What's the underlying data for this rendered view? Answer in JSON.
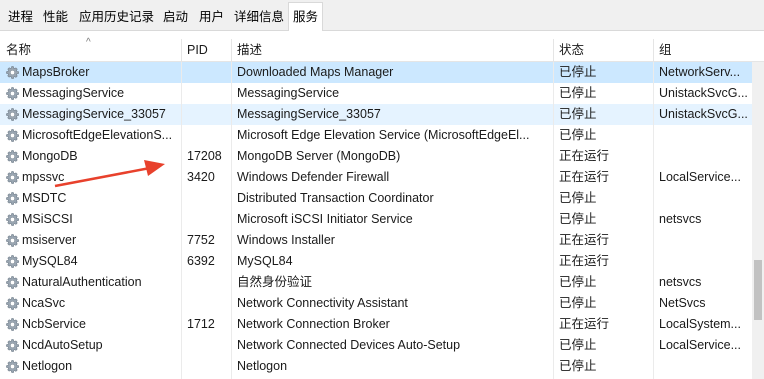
{
  "tabs": [
    "进程",
    "性能",
    "应用历史记录",
    "启动",
    "用户",
    "详细信息",
    "服务"
  ],
  "active_tab": "服务",
  "columns": {
    "name": "名称",
    "pid": "PID",
    "desc": "描述",
    "status": "状态",
    "group": "组"
  },
  "services": [
    {
      "name": "MapsBroker",
      "pid": "",
      "desc": "Downloaded Maps Manager",
      "status": "已停止",
      "group": "NetworkServ..."
    },
    {
      "name": "MessagingService",
      "pid": "",
      "desc": "MessagingService",
      "status": "已停止",
      "group": "UnistackSvcG..."
    },
    {
      "name": "MessagingService_33057",
      "pid": "",
      "desc": "MessagingService_33057",
      "status": "已停止",
      "group": "UnistackSvcG..."
    },
    {
      "name": "MicrosoftEdgeElevationS...",
      "pid": "",
      "desc": "Microsoft Edge Elevation Service (MicrosoftEdgeEl...",
      "status": "已停止",
      "group": ""
    },
    {
      "name": "MongoDB",
      "pid": "17208",
      "desc": "MongoDB Server (MongoDB)",
      "status": "正在运行",
      "group": ""
    },
    {
      "name": "mpssvc",
      "pid": "3420",
      "desc": "Windows Defender Firewall",
      "status": "正在运行",
      "group": "LocalService..."
    },
    {
      "name": "MSDTC",
      "pid": "",
      "desc": "Distributed Transaction Coordinator",
      "status": "已停止",
      "group": ""
    },
    {
      "name": "MSiSCSI",
      "pid": "",
      "desc": "Microsoft iSCSI Initiator Service",
      "status": "已停止",
      "group": "netsvcs"
    },
    {
      "name": "msiserver",
      "pid": "7752",
      "desc": "Windows Installer",
      "status": "正在运行",
      "group": ""
    },
    {
      "name": "MySQL84",
      "pid": "6392",
      "desc": "MySQL84",
      "status": "正在运行",
      "group": ""
    },
    {
      "name": "NaturalAuthentication",
      "pid": "",
      "desc": "自然身份验证",
      "status": "已停止",
      "group": "netsvcs"
    },
    {
      "name": "NcaSvc",
      "pid": "",
      "desc": "Network Connectivity Assistant",
      "status": "已停止",
      "group": "NetSvcs"
    },
    {
      "name": "NcbService",
      "pid": "1712",
      "desc": "Network Connection Broker",
      "status": "正在运行",
      "group": "LocalSystem..."
    },
    {
      "name": "NcdAutoSetup",
      "pid": "",
      "desc": "Network Connected Devices Auto-Setup",
      "status": "已停止",
      "group": "LocalService..."
    },
    {
      "name": "Netlogon",
      "pid": "",
      "desc": "Netlogon",
      "status": "已停止",
      "group": ""
    }
  ],
  "colors": {
    "selected": "#cce8ff",
    "hover": "#e5f3ff",
    "annotation_arrow": "#e8412c"
  },
  "icon": "gear-icon"
}
